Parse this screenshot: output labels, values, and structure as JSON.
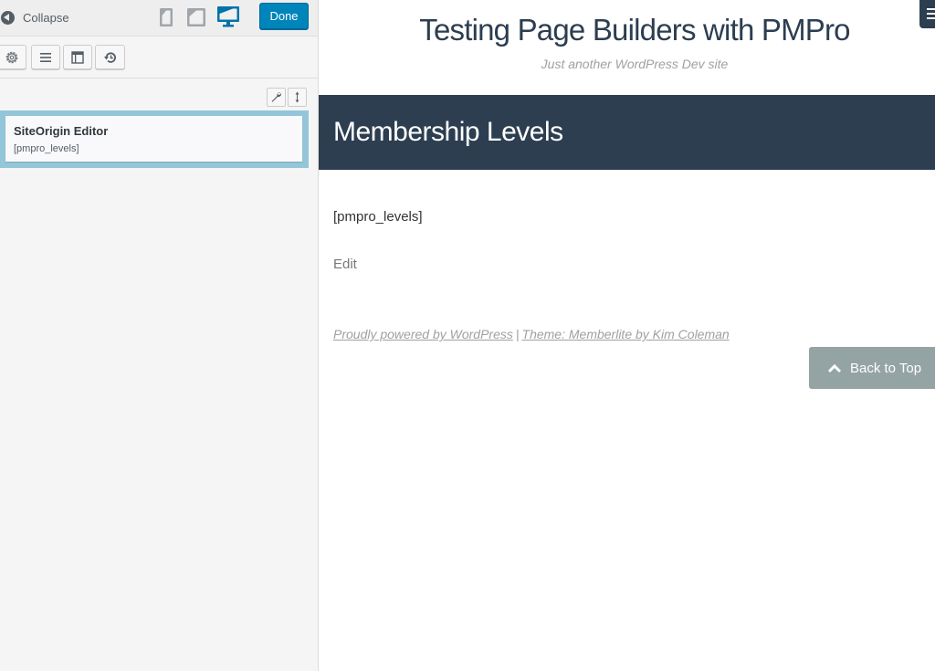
{
  "panel": {
    "collapse_label": "Collapse",
    "done_label": "Done",
    "devices": [
      {
        "name": "mobile",
        "active": false
      },
      {
        "name": "tablet",
        "active": false
      },
      {
        "name": "desktop",
        "active": true
      }
    ],
    "toolbar": [
      {
        "icon": "gear-icon",
        "title": "Settings"
      },
      {
        "icon": "rows-icon",
        "title": "Rows"
      },
      {
        "icon": "layout-icon",
        "title": "Layout"
      },
      {
        "icon": "history-icon",
        "title": "History"
      }
    ],
    "widget": {
      "title": "SiteOrigin Editor",
      "description": "[pmpro_levels]"
    }
  },
  "preview": {
    "site_title": "Testing Page Builders with PMPro",
    "tagline": "Just another WordPress Dev site",
    "page_title": "Membership Levels",
    "content": "[pmpro_levels]",
    "edit_label": "Edit",
    "footer": {
      "powered_by": "Proudly powered by WordPress",
      "separator": "|",
      "theme_credit": "Theme: Memberlite by Kim Coleman"
    },
    "back_to_top_label": "Back to Top"
  },
  "colors": {
    "accent_blue": "#0085ba",
    "dark_navy": "#2c3e50",
    "cell_highlight": "#93c6d9",
    "back_to_top_bg": "#94a4a5"
  }
}
